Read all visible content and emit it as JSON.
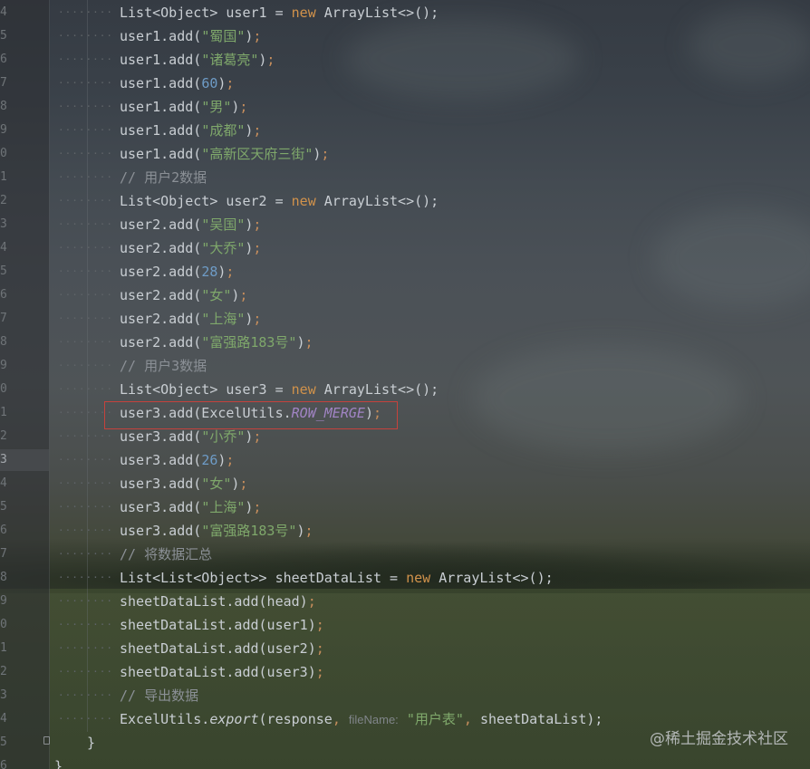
{
  "watermark": "@稀土掘金技术社区",
  "lines": [
    {
      "num": "4",
      "level": 2,
      "tokens": [
        [
          "plain",
          "List<Object> user1 = "
        ],
        [
          "kw",
          "new"
        ],
        [
          "plain",
          " ArrayList<>();"
        ]
      ]
    },
    {
      "num": "5",
      "level": 2,
      "tokens": [
        [
          "plain",
          "user1.add("
        ],
        [
          "str",
          "\"蜀国\""
        ],
        [
          "plain",
          ")"
        ],
        [
          "punc",
          ";"
        ]
      ]
    },
    {
      "num": "6",
      "level": 2,
      "tokens": [
        [
          "plain",
          "user1.add("
        ],
        [
          "str",
          "\"诸葛亮\""
        ],
        [
          "plain",
          ")"
        ],
        [
          "punc",
          ";"
        ]
      ]
    },
    {
      "num": "7",
      "level": 2,
      "tokens": [
        [
          "plain",
          "user1.add("
        ],
        [
          "num",
          "60"
        ],
        [
          "plain",
          ")"
        ],
        [
          "punc",
          ";"
        ]
      ]
    },
    {
      "num": "8",
      "level": 2,
      "tokens": [
        [
          "plain",
          "user1.add("
        ],
        [
          "str",
          "\"男\""
        ],
        [
          "plain",
          ")"
        ],
        [
          "punc",
          ";"
        ]
      ]
    },
    {
      "num": "9",
      "level": 2,
      "tokens": [
        [
          "plain",
          "user1.add("
        ],
        [
          "str",
          "\"成都\""
        ],
        [
          "plain",
          ")"
        ],
        [
          "punc",
          ";"
        ]
      ]
    },
    {
      "num": "0",
      "level": 2,
      "tokens": [
        [
          "plain",
          "user1.add("
        ],
        [
          "str",
          "\"高新区天府三街\""
        ],
        [
          "plain",
          ")"
        ],
        [
          "punc",
          ";"
        ]
      ]
    },
    {
      "num": "1",
      "level": 2,
      "tokens": [
        [
          "cmt",
          "// 用户2数据"
        ]
      ]
    },
    {
      "num": "2",
      "level": 2,
      "tokens": [
        [
          "plain",
          "List<Object> user2 = "
        ],
        [
          "kw",
          "new"
        ],
        [
          "plain",
          " ArrayList<>();"
        ]
      ]
    },
    {
      "num": "3",
      "level": 2,
      "tokens": [
        [
          "plain",
          "user2.add("
        ],
        [
          "str",
          "\"吴国\""
        ],
        [
          "plain",
          ")"
        ],
        [
          "punc",
          ";"
        ]
      ]
    },
    {
      "num": "4",
      "level": 2,
      "tokens": [
        [
          "plain",
          "user2.add("
        ],
        [
          "str",
          "\"大乔\""
        ],
        [
          "plain",
          ")"
        ],
        [
          "punc",
          ";"
        ]
      ]
    },
    {
      "num": "5",
      "level": 2,
      "tokens": [
        [
          "plain",
          "user2.add("
        ],
        [
          "num",
          "28"
        ],
        [
          "plain",
          ")"
        ],
        [
          "punc",
          ";"
        ]
      ]
    },
    {
      "num": "6",
      "level": 2,
      "tokens": [
        [
          "plain",
          "user2.add("
        ],
        [
          "str",
          "\"女\""
        ],
        [
          "plain",
          ")"
        ],
        [
          "punc",
          ";"
        ]
      ]
    },
    {
      "num": "7",
      "level": 2,
      "tokens": [
        [
          "plain",
          "user2.add("
        ],
        [
          "str",
          "\"上海\""
        ],
        [
          "plain",
          ")"
        ],
        [
          "punc",
          ";"
        ]
      ]
    },
    {
      "num": "8",
      "level": 2,
      "tokens": [
        [
          "plain",
          "user2.add("
        ],
        [
          "str",
          "\"富强路183号\""
        ],
        [
          "plain",
          ")"
        ],
        [
          "punc",
          ";"
        ]
      ]
    },
    {
      "num": "9",
      "level": 2,
      "tokens": [
        [
          "cmt",
          "// 用户3数据"
        ]
      ]
    },
    {
      "num": "0",
      "level": 2,
      "tokens": [
        [
          "plain",
          "List<Object> user3 = "
        ],
        [
          "kw",
          "new"
        ],
        [
          "plain",
          " ArrayList<>();"
        ]
      ]
    },
    {
      "num": "1",
      "level": 2,
      "tokens": [
        [
          "plain",
          "user3.add(ExcelUtils."
        ],
        [
          "const",
          "ROW_MERGE"
        ],
        [
          "plain",
          ")"
        ],
        [
          "punc",
          ";"
        ]
      ]
    },
    {
      "num": "2",
      "level": 2,
      "tokens": [
        [
          "plain",
          "user3.add("
        ],
        [
          "str",
          "\"小乔\""
        ],
        [
          "plain",
          ")"
        ],
        [
          "punc",
          ";"
        ]
      ]
    },
    {
      "num": "3",
      "level": 2,
      "active": true,
      "tokens": [
        [
          "plain",
          "user3.add("
        ],
        [
          "num",
          "26"
        ],
        [
          "plain",
          ")"
        ],
        [
          "punc",
          ";"
        ]
      ]
    },
    {
      "num": "4",
      "level": 2,
      "tokens": [
        [
          "plain",
          "user3.add("
        ],
        [
          "str",
          "\"女\""
        ],
        [
          "plain",
          ")"
        ],
        [
          "punc",
          ";"
        ]
      ]
    },
    {
      "num": "5",
      "level": 2,
      "tokens": [
        [
          "plain",
          "user3.add("
        ],
        [
          "str",
          "\"上海\""
        ],
        [
          "plain",
          ")"
        ],
        [
          "punc",
          ";"
        ]
      ]
    },
    {
      "num": "6",
      "level": 2,
      "tokens": [
        [
          "plain",
          "user3.add("
        ],
        [
          "str",
          "\"富强路183号\""
        ],
        [
          "plain",
          ")"
        ],
        [
          "punc",
          ";"
        ]
      ]
    },
    {
      "num": "7",
      "level": 2,
      "tokens": [
        [
          "cmt",
          "// 将数据汇总"
        ]
      ]
    },
    {
      "num": "8",
      "level": 2,
      "tokens": [
        [
          "plain",
          "List<List<Object>> sheetDataList = "
        ],
        [
          "kw",
          "new"
        ],
        [
          "plain",
          " ArrayList<>();"
        ]
      ]
    },
    {
      "num": "9",
      "level": 2,
      "tokens": [
        [
          "plain",
          "sheetDataList.add(head)"
        ],
        [
          "punc",
          ";"
        ]
      ]
    },
    {
      "num": "0",
      "level": 2,
      "tokens": [
        [
          "plain",
          "sheetDataList.add(user1)"
        ],
        [
          "punc",
          ";"
        ]
      ]
    },
    {
      "num": "1",
      "level": 2,
      "tokens": [
        [
          "plain",
          "sheetDataList.add(user2)"
        ],
        [
          "punc",
          ";"
        ]
      ]
    },
    {
      "num": "2",
      "level": 2,
      "tokens": [
        [
          "plain",
          "sheetDataList.add(user3)"
        ],
        [
          "punc",
          ";"
        ]
      ]
    },
    {
      "num": "3",
      "level": 2,
      "tokens": [
        [
          "cmt",
          "// 导出数据"
        ]
      ]
    },
    {
      "num": "4",
      "level": 2,
      "tokens": [
        [
          "plain",
          "ExcelUtils."
        ],
        [
          "it",
          "export"
        ],
        [
          "plain",
          "(response"
        ],
        [
          "punc",
          ","
        ],
        [
          "plain",
          " "
        ],
        [
          "hint",
          "fileName:"
        ],
        [
          "plain",
          " "
        ],
        [
          "str",
          "\"用户表\""
        ],
        [
          "punc",
          ","
        ],
        [
          "plain",
          " sheetDataList);"
        ]
      ]
    },
    {
      "num": "5",
      "level": 1,
      "tokens": [
        [
          "plain",
          "}"
        ]
      ]
    },
    {
      "num": "6",
      "level": 0,
      "tokens": [
        [
          "plain",
          "}"
        ]
      ]
    }
  ]
}
